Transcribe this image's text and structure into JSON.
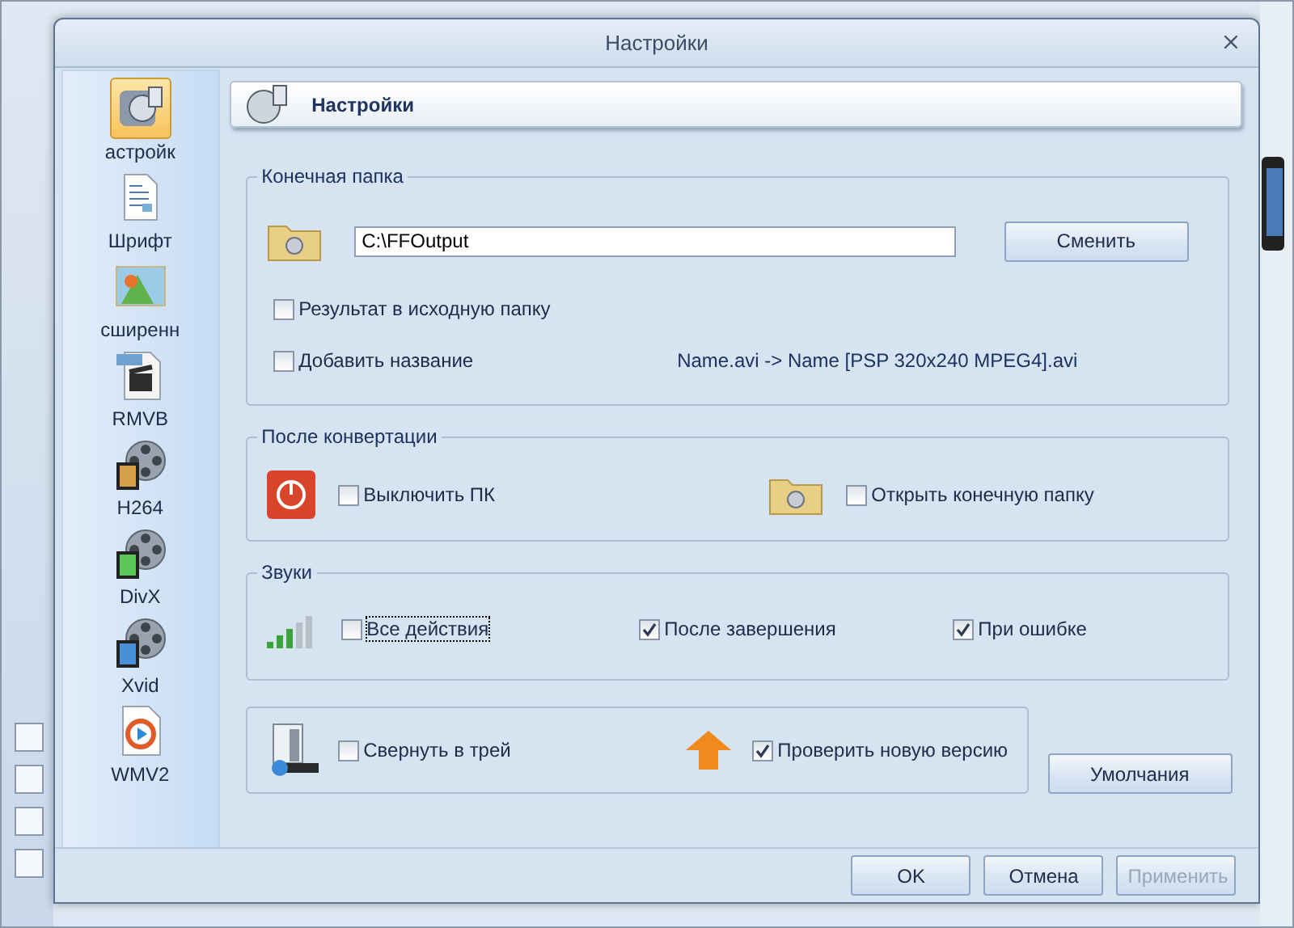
{
  "window": {
    "title": "Настройки"
  },
  "sidebar": {
    "items": [
      {
        "label": "астройк",
        "kind": "settings",
        "selected": true
      },
      {
        "label": "Шрифт",
        "kind": "font",
        "selected": false
      },
      {
        "label": "сширенн",
        "kind": "picture",
        "selected": false
      },
      {
        "label": "RMVB",
        "kind": "real",
        "selected": false
      },
      {
        "label": "H264",
        "kind": "reel",
        "color": "#d9a04a",
        "selected": false
      },
      {
        "label": "DivX",
        "kind": "reel",
        "color": "#5cc85c",
        "selected": false
      },
      {
        "label": "Xvid",
        "kind": "reel",
        "color": "#4a90d9",
        "selected": false
      },
      {
        "label": "WMV2",
        "kind": "media",
        "selected": false
      }
    ]
  },
  "header": {
    "title": "Настройки"
  },
  "output_folder": {
    "title": "Конечная папка",
    "path": "C:\\FFOutput",
    "change_button": "Сменить",
    "options": [
      {
        "label": "Результат в исходную папку",
        "checked": false
      },
      {
        "label": "Добавить название",
        "checked": false
      }
    ],
    "name_example": "Name.avi  -> Name [PSP 320x240 MPEG4].avi"
  },
  "after_conversion": {
    "title": "После конвертации",
    "options": [
      {
        "label": "Выключить ПК",
        "kind": "power",
        "checked": false
      },
      {
        "label": "Открыть конечную папку",
        "kind": "folder",
        "checked": false
      }
    ]
  },
  "sounds": {
    "title": "Звуки",
    "options": [
      {
        "label": "Все действия",
        "checked": false,
        "focused": true
      },
      {
        "label": "После завершения",
        "checked": true,
        "focused": false
      },
      {
        "label": "При ошибке",
        "checked": true,
        "focused": false
      }
    ]
  },
  "misc": {
    "options": [
      {
        "label": "Свернуть в трей",
        "kind": "tray",
        "checked": false
      },
      {
        "label": "Проверить новую версию",
        "kind": "update",
        "checked": true
      }
    ]
  },
  "defaults_button": "Умолчания",
  "footer": {
    "buttons": [
      {
        "label": "OK",
        "disabled": false
      },
      {
        "label": "Отмена",
        "disabled": false
      },
      {
        "label": "Применить",
        "disabled": true
      }
    ]
  }
}
